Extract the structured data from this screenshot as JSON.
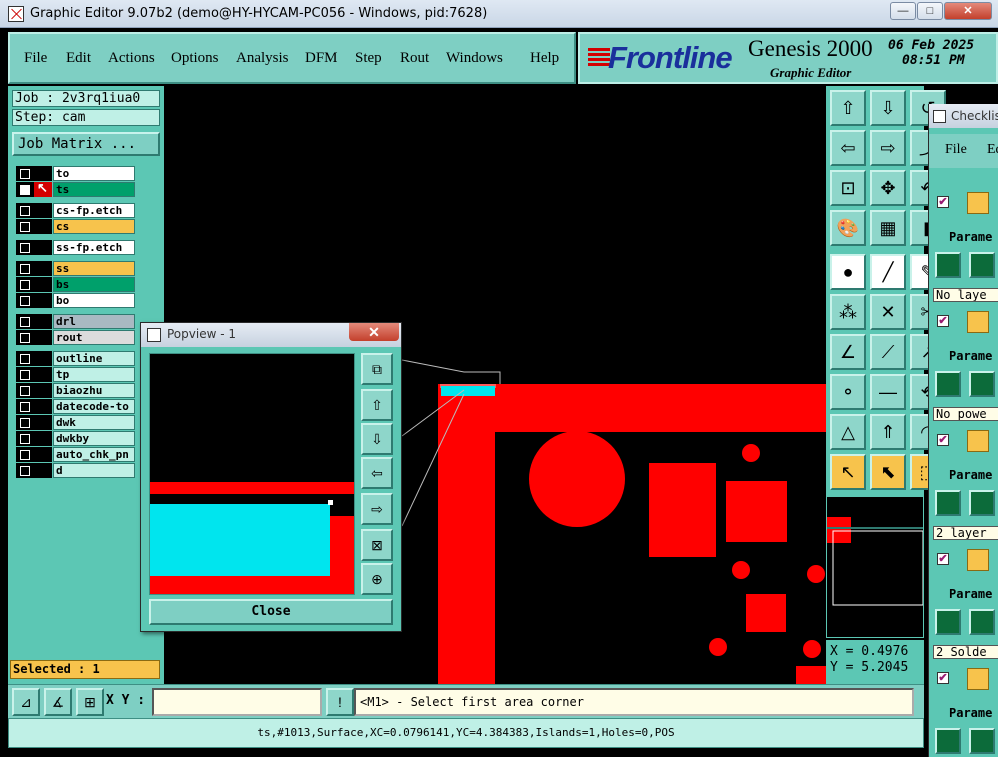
{
  "window": {
    "title": "Graphic Editor 9.07b2 (demo@HY-HYCAM-PC056 - Windows, pid:7628)",
    "min_label": "—",
    "max_label": "□",
    "close_label": "✕"
  },
  "menu": {
    "items": [
      {
        "label": "File"
      },
      {
        "label": "Edit"
      },
      {
        "label": "Actions"
      },
      {
        "label": "Options"
      },
      {
        "label": "Analysis"
      },
      {
        "label": "DFM"
      },
      {
        "label": "Step"
      },
      {
        "label": "Rout"
      },
      {
        "label": "Windows"
      },
      {
        "label": "Help"
      }
    ]
  },
  "brand": {
    "logo": "Frontline",
    "product": "Genesis 2000",
    "subtitle": "Graphic Editor",
    "date": "06 Feb 2025",
    "time": "08:51 PM"
  },
  "job": {
    "job_line": "Job : 2v3rq1iua0",
    "step_line": "Step: cam",
    "matrix_button": "Job Matrix ..."
  },
  "layers": [
    {
      "name": "to",
      "color": "#ffffff",
      "displayed": false,
      "affected": false
    },
    {
      "name": "ts",
      "color": "#00a06b",
      "displayed": true,
      "affected": true
    },
    {
      "name": "cs-fp.etch",
      "color": "#ffffff",
      "displayed": false,
      "affected": false
    },
    {
      "name": "cs",
      "color": "#f7c34c",
      "displayed": false,
      "affected": false
    },
    {
      "name": "ss-fp.etch",
      "color": "#ffffff",
      "displayed": false,
      "affected": false
    },
    {
      "name": "ss",
      "color": "#f7c34c",
      "displayed": false,
      "affected": false
    },
    {
      "name": "bs",
      "color": "#00a06b",
      "displayed": false,
      "affected": false
    },
    {
      "name": "bo",
      "color": "#ffffff",
      "displayed": false,
      "affected": false
    },
    {
      "name": "drl",
      "color": "#a9b9c2",
      "displayed": false,
      "affected": false
    },
    {
      "name": "rout",
      "color": "#dcdcdc",
      "displayed": false,
      "affected": false
    },
    {
      "name": "outline",
      "color": "#bff0e6",
      "displayed": false,
      "affected": false
    },
    {
      "name": "tp",
      "color": "#bff0e6",
      "displayed": false,
      "affected": false
    },
    {
      "name": "biaozhu",
      "color": "#bff0e6",
      "displayed": false,
      "affected": false
    },
    {
      "name": "datecode-to",
      "color": "#bff0e6",
      "displayed": false,
      "affected": false
    },
    {
      "name": "dwk",
      "color": "#bff0e6",
      "displayed": false,
      "affected": false
    },
    {
      "name": "dwkby",
      "color": "#bff0e6",
      "displayed": false,
      "affected": false
    },
    {
      "name": "auto_chk_pn",
      "color": "#bff0e6",
      "displayed": false,
      "affected": false
    },
    {
      "name": "d",
      "color": "#bff0e6",
      "displayed": false,
      "affected": false
    }
  ],
  "selected": "Selected : 1",
  "popview": {
    "title": "Popview - 1",
    "close_label": "Close",
    "title_close": "✕"
  },
  "coords": {
    "x": "X = 0.4976",
    "y": "Y = 5.2045"
  },
  "bottom": {
    "xy_label": "X Y :",
    "xy_value": "",
    "message": "<M1> - Select first area corner",
    "warn_label": "!"
  },
  "status": "ts,#1013,Surface,XC=0.0796141,YC=4.384383,Islands=1,Holes=0,POS",
  "checklist": {
    "title": "Checklist",
    "menu": [
      "File",
      "Ed"
    ],
    "param_label": "Parame",
    "rows": [
      "No laye",
      "No powe",
      "2 layer",
      "2 Solde"
    ]
  },
  "colors": {
    "panel": "#5cc7b4",
    "copper": "#ff0000",
    "highlight": "#00e5ee",
    "accent": "#f7c34c"
  }
}
